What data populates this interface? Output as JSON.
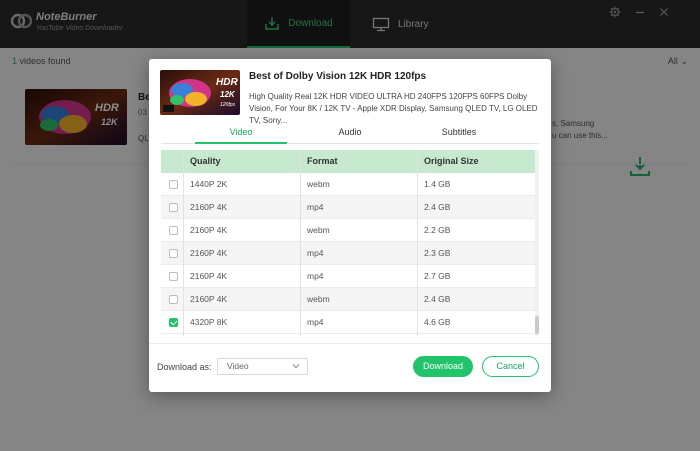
{
  "app": {
    "brand": "NoteBurner",
    "brand_sub": "YouTube Video Downloader",
    "tabs": [
      {
        "label": "Download",
        "icon": "download-tray-icon",
        "active": true
      },
      {
        "label": "Library",
        "icon": "monitor-icon",
        "active": false
      }
    ],
    "window_controls": [
      "gear-icon",
      "minimize-icon",
      "close-icon"
    ],
    "accent_color": "#21c36b"
  },
  "main": {
    "videos_found_count": "1",
    "videos_found_label": "videos found",
    "filter_label": "All",
    "item": {
      "title_partial": "Be",
      "meta_partial": "03",
      "desc_partial": "QL",
      "right_text_line1": "s, Samsung",
      "right_text_line2": "u can use this..."
    }
  },
  "modal": {
    "thumb_badge": "HDR",
    "thumb_sub1": "12K",
    "thumb_sub2": "120fps",
    "title": "Best of Dolby Vision 12K HDR 120fps",
    "description": "High Quality Real 12K HDR VIDEO ULTRA HD 240FPS 120FPS 60FPS Dolby Vision, For Your 8K / 12K TV - Apple XDR Display, Samsung QLED TV, LG OLED TV, Sony...",
    "tabs": [
      {
        "label": "Video",
        "active": true
      },
      {
        "label": "Audio",
        "active": false
      },
      {
        "label": "Subtitles",
        "active": false
      }
    ],
    "columns": [
      "Quality",
      "Format",
      "Original Size"
    ],
    "rows": [
      {
        "quality": "1440P 2K",
        "format": "webm",
        "size": "1.4 GB",
        "checked": false
      },
      {
        "quality": "2160P 4K",
        "format": "mp4",
        "size": "2.4 GB",
        "checked": false
      },
      {
        "quality": "2160P 4K",
        "format": "webm",
        "size": "2.2 GB",
        "checked": false
      },
      {
        "quality": "2160P 4K",
        "format": "mp4",
        "size": "2.3 GB",
        "checked": false
      },
      {
        "quality": "2160P 4K",
        "format": "mp4",
        "size": "2.7 GB",
        "checked": false
      },
      {
        "quality": "2160P 4K",
        "format": "webm",
        "size": "2.4 GB",
        "checked": false
      },
      {
        "quality": "4320P 8K",
        "format": "mp4",
        "size": "4.6 GB",
        "checked": true
      }
    ],
    "download_as_label": "Download as:",
    "download_as_value": "Video",
    "download_button": "Download",
    "cancel_button": "Cancel"
  }
}
